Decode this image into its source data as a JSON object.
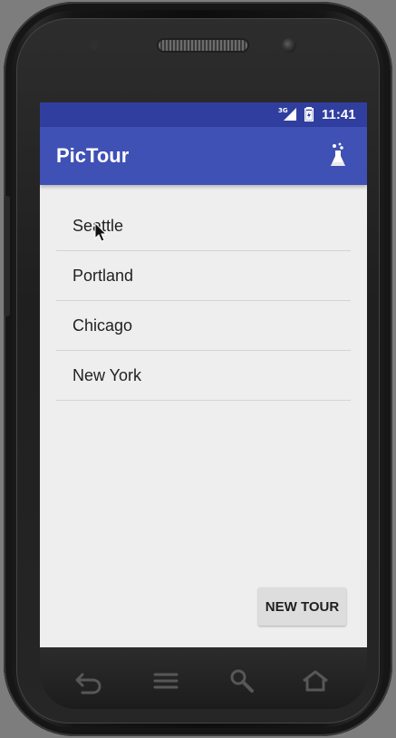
{
  "device": {
    "status_bar": {
      "network": "3G",
      "time": "11:41"
    }
  },
  "app": {
    "title": "PicTour",
    "action_icon": "flask-icon"
  },
  "cities": [
    {
      "label": "Seattle"
    },
    {
      "label": "Portland"
    },
    {
      "label": "Chicago"
    },
    {
      "label": "New York"
    }
  ],
  "actions": {
    "new_tour_label": "NEW TOUR"
  },
  "navigation": {
    "icons": [
      "back-icon",
      "menu-icon",
      "search-icon",
      "home-icon"
    ]
  },
  "colors": {
    "status_bar": "#303f9f",
    "toolbar": "#3f51b5",
    "screen_background": "#eeeeee",
    "button_background": "#dddddd",
    "divider": "#d4d4d4",
    "text": "#222222"
  }
}
